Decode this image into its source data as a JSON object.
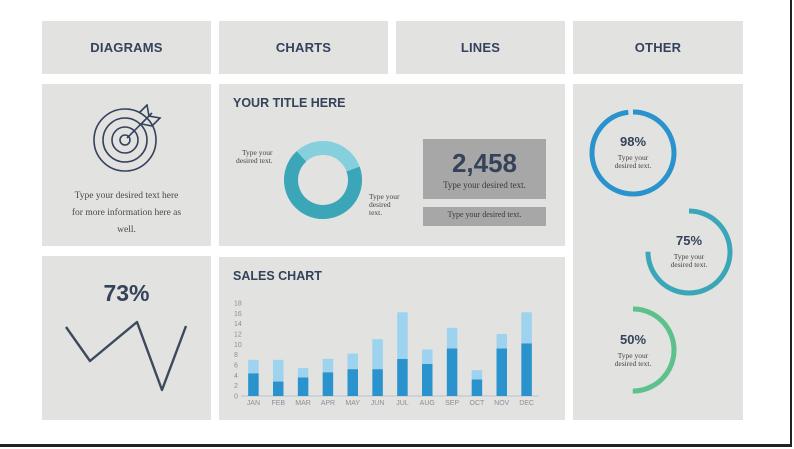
{
  "header": {
    "diagrams": "DIAGRAMS",
    "charts": "CHARTS",
    "lines": "LINES",
    "other": "OTHER"
  },
  "diagram_card": {
    "icon": "target-arrow-icon",
    "text_line1": "Type your desired text here",
    "text_line2": "for more information here as",
    "text_line3": "well."
  },
  "title_card": {
    "title": "YOUR TITLE HERE",
    "donut_label_left_1": "Type your",
    "donut_label_left_2": "desired text.",
    "donut_label_right_1": "Type your",
    "donut_label_right_2": "desired",
    "donut_label_right_3": "text.",
    "big_number": "2,458",
    "big_number_caption": "Type your desired text.",
    "bar_caption": "Type your desired text."
  },
  "line_card": {
    "percent": "73%"
  },
  "sales_card": {
    "title": "SALES CHART"
  },
  "chart_data": {
    "type": "bar",
    "title": "SALES CHART",
    "categories": [
      "JAN",
      "FEB",
      "MAR",
      "APR",
      "MAY",
      "JUN",
      "JUL",
      "AUG",
      "SEP",
      "OCT",
      "NOV",
      "DEC"
    ],
    "series": [
      {
        "values": [
          4.4,
          2.8,
          3.6,
          4.6,
          5.2,
          5.2,
          7.2,
          6.2,
          9.2,
          3.2,
          9.2,
          10.2
        ]
      },
      {
        "values": [
          2.6,
          4.2,
          1.8,
          2.6,
          3.0,
          5.8,
          9.0,
          2.8,
          4.0,
          1.8,
          2.8,
          6.0
        ]
      }
    ],
    "yticks": [
      0,
      2,
      4,
      6,
      8,
      10,
      12,
      14,
      16,
      18
    ],
    "ylim": [
      0,
      18
    ],
    "stacked": true,
    "colors": [
      "#2a93cd",
      "#9dd3ef"
    ],
    "grid": false
  },
  "other_card": {
    "ring1_percent": "98%",
    "ring1_text1": "Type your",
    "ring1_text2": "desired text.",
    "ring2_percent": "75%",
    "ring2_text1": "Type your",
    "ring2_text2": "desired text.",
    "ring3_percent": "50%",
    "ring3_text1": "Type your",
    "ring3_text2": "desired text."
  },
  "colors": {
    "panel": "#e2e2e0",
    "ring1": "#2a93cd",
    "ring2": "#3aa6b8",
    "ring3": "#5cc18a",
    "donut_dark": "#3aa6b8",
    "donut_light": "#86cfdc",
    "navy": "#34425a"
  }
}
